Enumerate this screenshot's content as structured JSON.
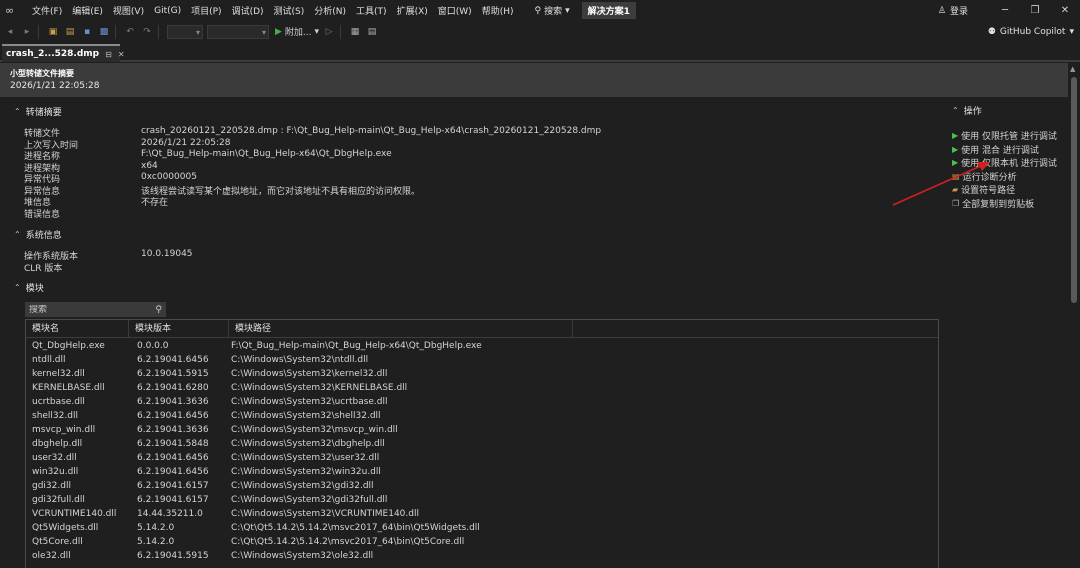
{
  "menubar": {
    "items": [
      "文件(F)",
      "编辑(E)",
      "视图(V)",
      "Git(G)",
      "项目(P)",
      "调试(D)",
      "测试(S)",
      "分析(N)",
      "工具(T)",
      "扩展(X)",
      "窗口(W)",
      "帮助(H)"
    ],
    "search_label": "搜索",
    "solution_label": "解决方案1",
    "login_label": "登录"
  },
  "toolbar": {
    "attach_label": "附加...",
    "copilot_label": "GitHub Copilot"
  },
  "tab": {
    "name": "crash_2...528.dmp",
    "pin_glyph": "⊟",
    "close_glyph": "✕"
  },
  "header": {
    "title": "小型转储文件摘要",
    "timestamp": "2026/1/21 22:05:28"
  },
  "dump_summary": {
    "title": "转储摘要",
    "rows": [
      {
        "label": "转储文件",
        "value": "crash_20260121_220528.dmp : F:\\Qt_Bug_Help-main\\Qt_Bug_Help-x64\\crash_20260121_220528.dmp"
      },
      {
        "label": "上次写入时间",
        "value": "2026/1/21 22:05:28"
      },
      {
        "label": "进程名称",
        "value": "F:\\Qt_Bug_Help-main\\Qt_Bug_Help-x64\\Qt_DbgHelp.exe"
      },
      {
        "label": "进程架构",
        "value": "x64"
      },
      {
        "label": "异常代码",
        "value": "0xc0000005"
      },
      {
        "label": "异常信息",
        "value": "该线程尝试读写某个虚拟地址，而它对该地址不具有相应的访问权限。"
      },
      {
        "label": "堆信息",
        "value": "不存在"
      },
      {
        "label": "错误信息",
        "value": ""
      }
    ]
  },
  "system_info": {
    "title": "系统信息",
    "rows": [
      {
        "label": "操作系统版本",
        "value": "10.0.19045"
      },
      {
        "label": "CLR 版本",
        "value": ""
      }
    ]
  },
  "modules": {
    "title": "模块",
    "search_placeholder": "搜索",
    "columns": [
      "模块名",
      "模块版本",
      "模块路径"
    ],
    "rows": [
      [
        "Qt_DbgHelp.exe",
        "0.0.0.0",
        "F:\\Qt_Bug_Help-main\\Qt_Bug_Help-x64\\Qt_DbgHelp.exe"
      ],
      [
        "ntdll.dll",
        "6.2.19041.6456",
        "C:\\Windows\\System32\\ntdll.dll"
      ],
      [
        "kernel32.dll",
        "6.2.19041.5915",
        "C:\\Windows\\System32\\kernel32.dll"
      ],
      [
        "KERNELBASE.dll",
        "6.2.19041.6280",
        "C:\\Windows\\System32\\KERNELBASE.dll"
      ],
      [
        "ucrtbase.dll",
        "6.2.19041.3636",
        "C:\\Windows\\System32\\ucrtbase.dll"
      ],
      [
        "shell32.dll",
        "6.2.19041.6456",
        "C:\\Windows\\System32\\shell32.dll"
      ],
      [
        "msvcp_win.dll",
        "6.2.19041.3636",
        "C:\\Windows\\System32\\msvcp_win.dll"
      ],
      [
        "dbghelp.dll",
        "6.2.19041.5848",
        "C:\\Windows\\System32\\dbghelp.dll"
      ],
      [
        "user32.dll",
        "6.2.19041.6456",
        "C:\\Windows\\System32\\user32.dll"
      ],
      [
        "win32u.dll",
        "6.2.19041.6456",
        "C:\\Windows\\System32\\win32u.dll"
      ],
      [
        "gdi32.dll",
        "6.2.19041.6157",
        "C:\\Windows\\System32\\gdi32.dll"
      ],
      [
        "gdi32full.dll",
        "6.2.19041.6157",
        "C:\\Windows\\System32\\gdi32full.dll"
      ],
      [
        "VCRUNTIME140.dll",
        "14.44.35211.0",
        "C:\\Windows\\System32\\VCRUNTIME140.dll"
      ],
      [
        "Qt5Widgets.dll",
        "5.14.2.0",
        "C:\\Qt\\Qt5.14.2\\5.14.2\\msvc2017_64\\bin\\Qt5Widgets.dll"
      ],
      [
        "Qt5Core.dll",
        "5.14.2.0",
        "C:\\Qt\\Qt5.14.2\\5.14.2\\msvc2017_64\\bin\\Qt5Core.dll"
      ],
      [
        "ole32.dll",
        "6.2.19041.5915",
        "C:\\Windows\\System32\\ole32.dll"
      ]
    ]
  },
  "actions": {
    "title": "操作",
    "items": [
      "使用 仅限托管 进行调试",
      "使用 混合 进行调试",
      "使用 仅限本机 进行调试",
      "运行诊断分析",
      "设置符号路径",
      "全部复制到剪贴板"
    ]
  },
  "colors": {
    "background": "#1f1f1f",
    "header_band": "#3b3b3b",
    "play_green": "#4ec04e",
    "annotation_arrow": "#d02020"
  }
}
